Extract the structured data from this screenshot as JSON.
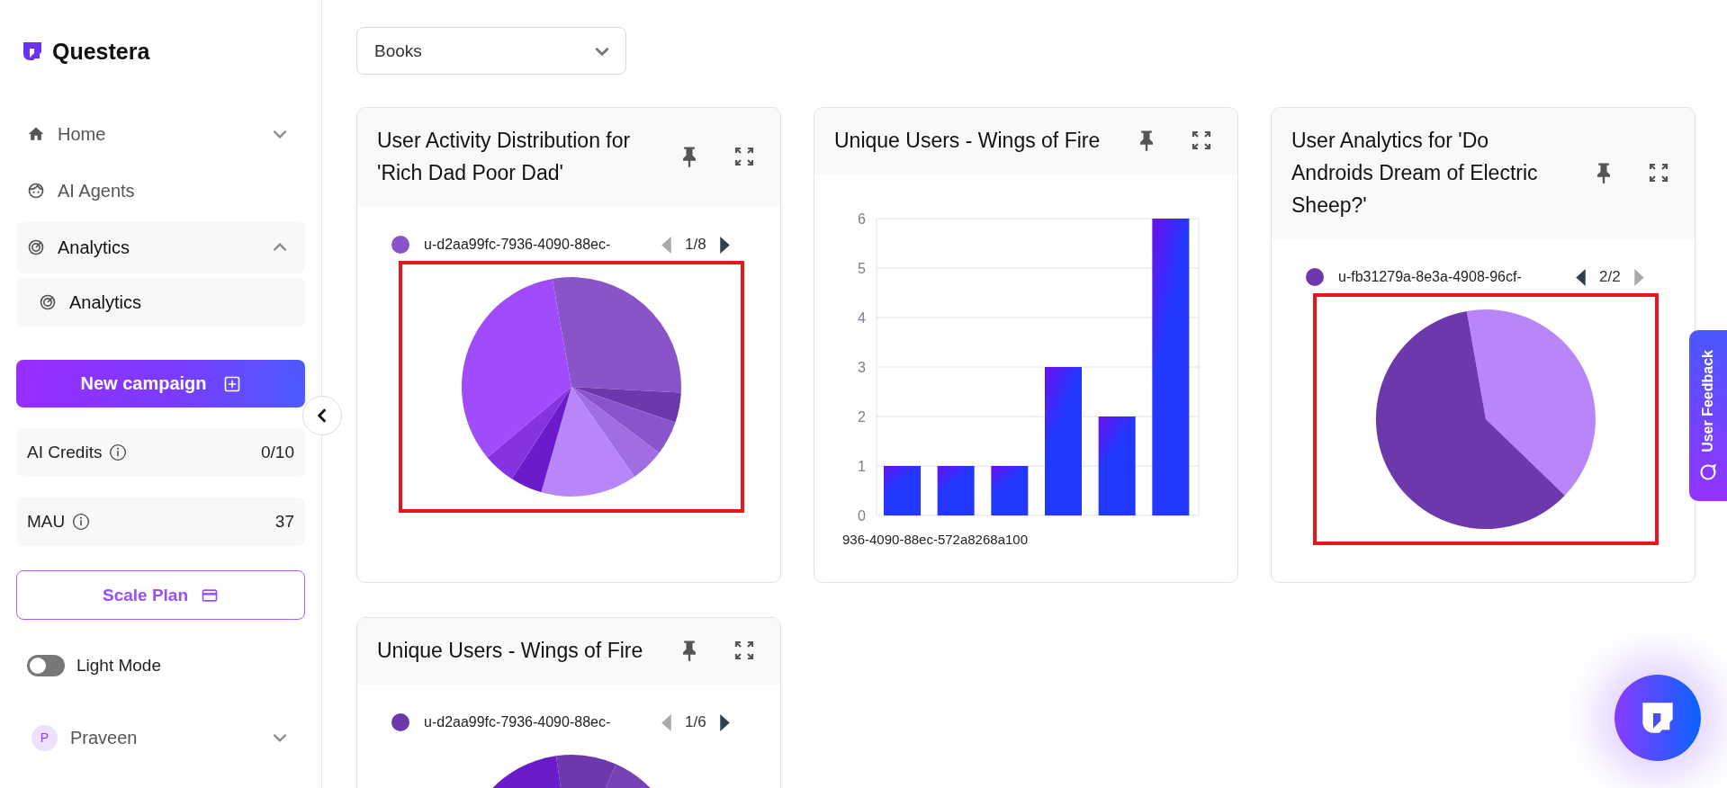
{
  "sidebar": {
    "brand": "Questera",
    "nav": [
      {
        "label": "Home",
        "kind": "group",
        "expanded": false
      },
      {
        "label": "AI Agents",
        "kind": "link"
      },
      {
        "label": "Analytics",
        "kind": "group",
        "expanded": true,
        "children": [
          {
            "label": "Analytics",
            "selected": true
          }
        ]
      }
    ],
    "new_campaign": "New campaign",
    "stats": [
      {
        "label": "AI Credits",
        "value": "0/10"
      },
      {
        "label": "MAU",
        "value": "37"
      }
    ],
    "scale_plan": "Scale Plan",
    "theme_toggle": {
      "label": "Light Mode",
      "on": false
    },
    "user": {
      "initial": "P",
      "name": "Praveen"
    }
  },
  "filter": {
    "value": "Books"
  },
  "cards": [
    {
      "title": "User Activity Distribution for 'Rich Dad Poor Dad'",
      "kind": "pie",
      "legend": {
        "label": "u-d2aa99fc-7936-4090-88ec-",
        "color": "#8854c8",
        "page": "1/8",
        "prev_disabled": true,
        "next_disabled": false
      },
      "highlighted": true
    },
    {
      "title": "Unique Users - Wings of Fire",
      "kind": "bar",
      "chart_data": {
        "type": "bar",
        "values": [
          1,
          1,
          1,
          3,
          2,
          6
        ],
        "ylim": [
          0,
          6
        ],
        "yticks": [
          0,
          1,
          2,
          3,
          4,
          5,
          6
        ],
        "grid": true
      },
      "category_label": "936-4090-88ec-572a8268a100"
    },
    {
      "title": "User Analytics for 'Do Androids Dream of Electric Sheep?'",
      "kind": "pie",
      "legend": {
        "label": "u-fb31279a-8e3a-4908-96cf-",
        "color": "#6e38ad",
        "page": "2/2",
        "prev_disabled": false,
        "next_disabled": true
      },
      "highlighted": true
    },
    {
      "title": "Unique Users - Wings of Fire",
      "kind": "pie",
      "legend": {
        "label": "u-d2aa99fc-7936-4090-88ec-",
        "color": "#6e38ad",
        "page": "1/6",
        "prev_disabled": true,
        "next_disabled": false
      },
      "highlighted": false
    }
  ],
  "feedback_tab": "User Feedback"
}
